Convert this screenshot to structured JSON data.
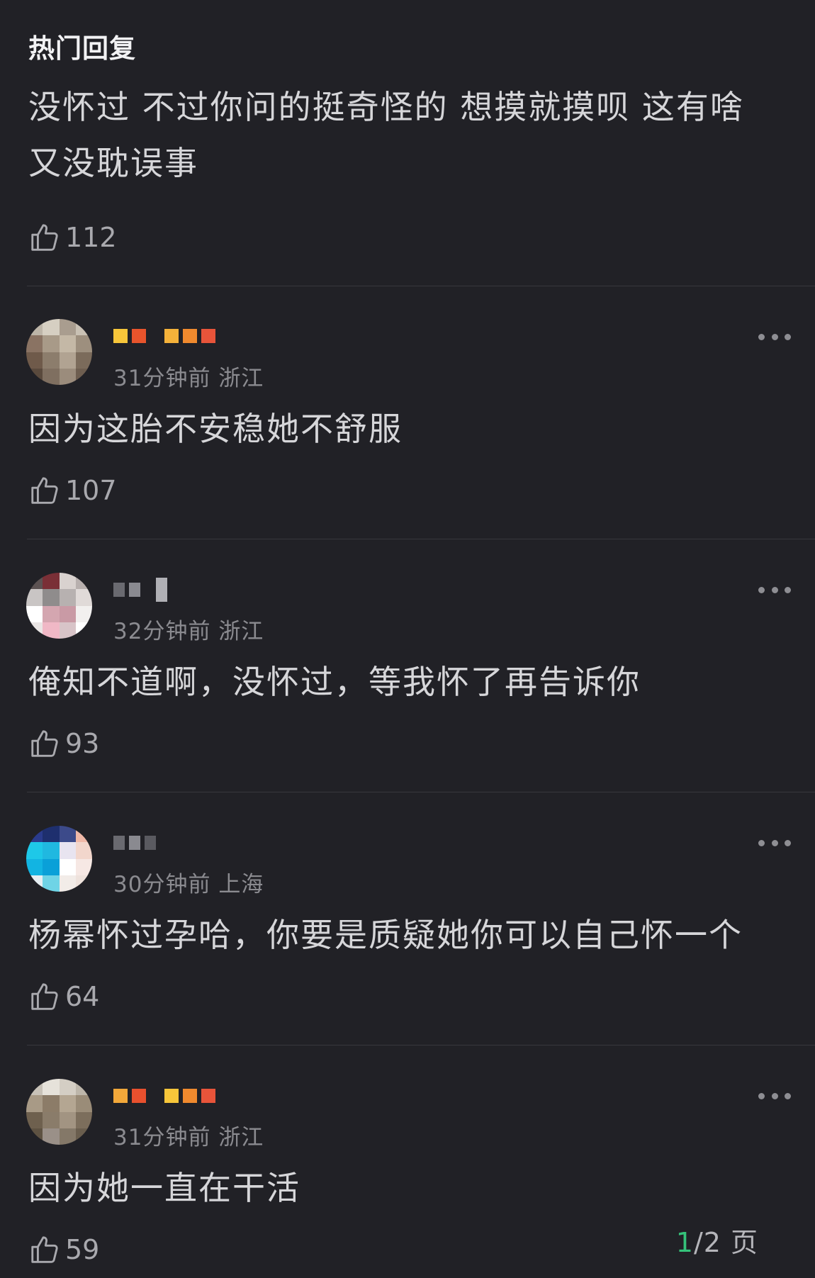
{
  "header": {
    "title": "热门回复"
  },
  "comments": [
    {
      "text": "没怀过 不过你问的挺奇怪的 想摸就摸呗 这有啥 又没耽误事",
      "likes": "112"
    },
    {
      "time": "31分钟前",
      "location": "浙江",
      "text": "因为这胎不安稳她不舒服",
      "likes": "107"
    },
    {
      "time": "32分钟前",
      "location": "浙江",
      "text": "俺知不道啊，没怀过，等我怀了再告诉你",
      "likes": "93"
    },
    {
      "time": "30分钟前",
      "location": "上海",
      "text": "杨幂怀过孕哈，你要是质疑她你可以自己怀一个",
      "likes": "64"
    },
    {
      "time": "31分钟前",
      "location": "浙江",
      "text": "因为她一直在干活",
      "likes": "59"
    }
  ],
  "pager": {
    "current": "1",
    "total_label": "/2 页"
  },
  "icons": {
    "like": "thumbs-up-outline-icon",
    "more": "more-horizontal-icon"
  },
  "colors": {
    "background": "#212126",
    "pager_current": "#35c27a"
  }
}
